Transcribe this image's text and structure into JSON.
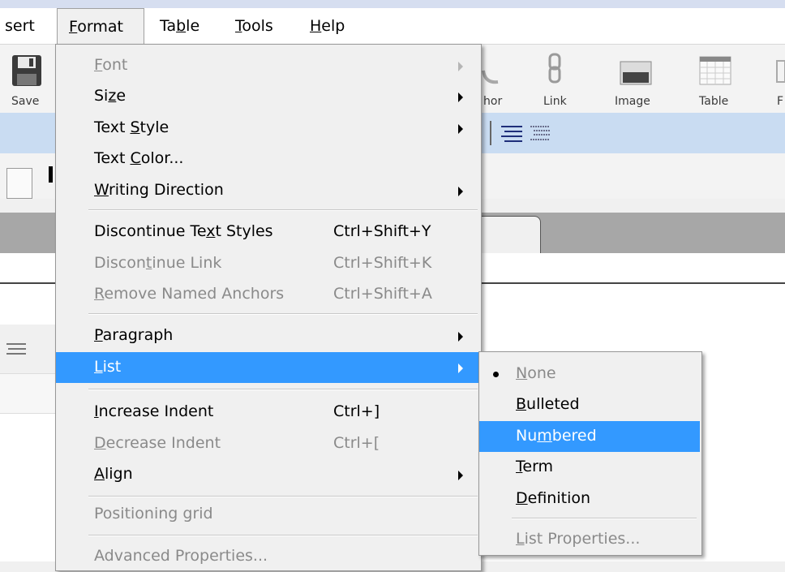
{
  "menubar": {
    "items": [
      "sert",
      "Format",
      "Table",
      "Tools",
      "Help"
    ],
    "open_item": "Format"
  },
  "toolbar": {
    "save_label": "Save",
    "anchor_label": "hor",
    "link_label": "Link",
    "image_label": "Image",
    "table_label": "Table",
    "partial_label": "F"
  },
  "format_menu": {
    "items": [
      {
        "label": "Font",
        "shortcut": "",
        "submenu": true,
        "disabled": true
      },
      {
        "label": "Size",
        "shortcut": "",
        "submenu": true,
        "disabled": false
      },
      {
        "label": "Text Style",
        "shortcut": "",
        "submenu": true,
        "disabled": false
      },
      {
        "label": "Text Color...",
        "shortcut": "",
        "submenu": false,
        "disabled": false
      },
      {
        "label": "Writing Direction",
        "shortcut": "",
        "submenu": true,
        "disabled": false
      },
      {
        "label": "Discontinue Text Styles",
        "shortcut": "Ctrl+Shift+Y",
        "submenu": false,
        "disabled": false
      },
      {
        "label": "Discontinue Link",
        "shortcut": "Ctrl+Shift+K",
        "submenu": false,
        "disabled": true
      },
      {
        "label": "Remove Named Anchors",
        "shortcut": "Ctrl+Shift+A",
        "submenu": false,
        "disabled": true
      },
      {
        "label": "Paragraph",
        "shortcut": "",
        "submenu": true,
        "disabled": false
      },
      {
        "label": "List",
        "shortcut": "",
        "submenu": true,
        "disabled": false,
        "highlighted": true
      },
      {
        "label": "Increase Indent",
        "shortcut": "Ctrl+]",
        "submenu": false,
        "disabled": false
      },
      {
        "label": "Decrease Indent",
        "shortcut": "Ctrl+[",
        "submenu": false,
        "disabled": true
      },
      {
        "label": "Align",
        "shortcut": "",
        "submenu": true,
        "disabled": false
      },
      {
        "label": "Positioning grid",
        "shortcut": "",
        "submenu": false,
        "disabled": true
      },
      {
        "label": "Advanced Properties...",
        "shortcut": "",
        "submenu": false,
        "disabled": true
      }
    ]
  },
  "list_submenu": {
    "items": [
      {
        "label": "None",
        "checked": true,
        "disabled": true
      },
      {
        "label": "Bulleted",
        "checked": false,
        "disabled": false
      },
      {
        "label": "Numbered",
        "checked": false,
        "disabled": false,
        "highlighted": true
      },
      {
        "label": "Term",
        "checked": false,
        "disabled": false
      },
      {
        "label": "Definition",
        "checked": false,
        "disabled": false
      },
      {
        "label": "List Properties...",
        "checked": false,
        "disabled": true
      }
    ]
  },
  "colors": {
    "highlight": "#3399ff",
    "menu_bg": "#f0f0f0",
    "disabled_text": "#8a8a8a",
    "toolbar_blue_row": "#c9dcf2"
  }
}
